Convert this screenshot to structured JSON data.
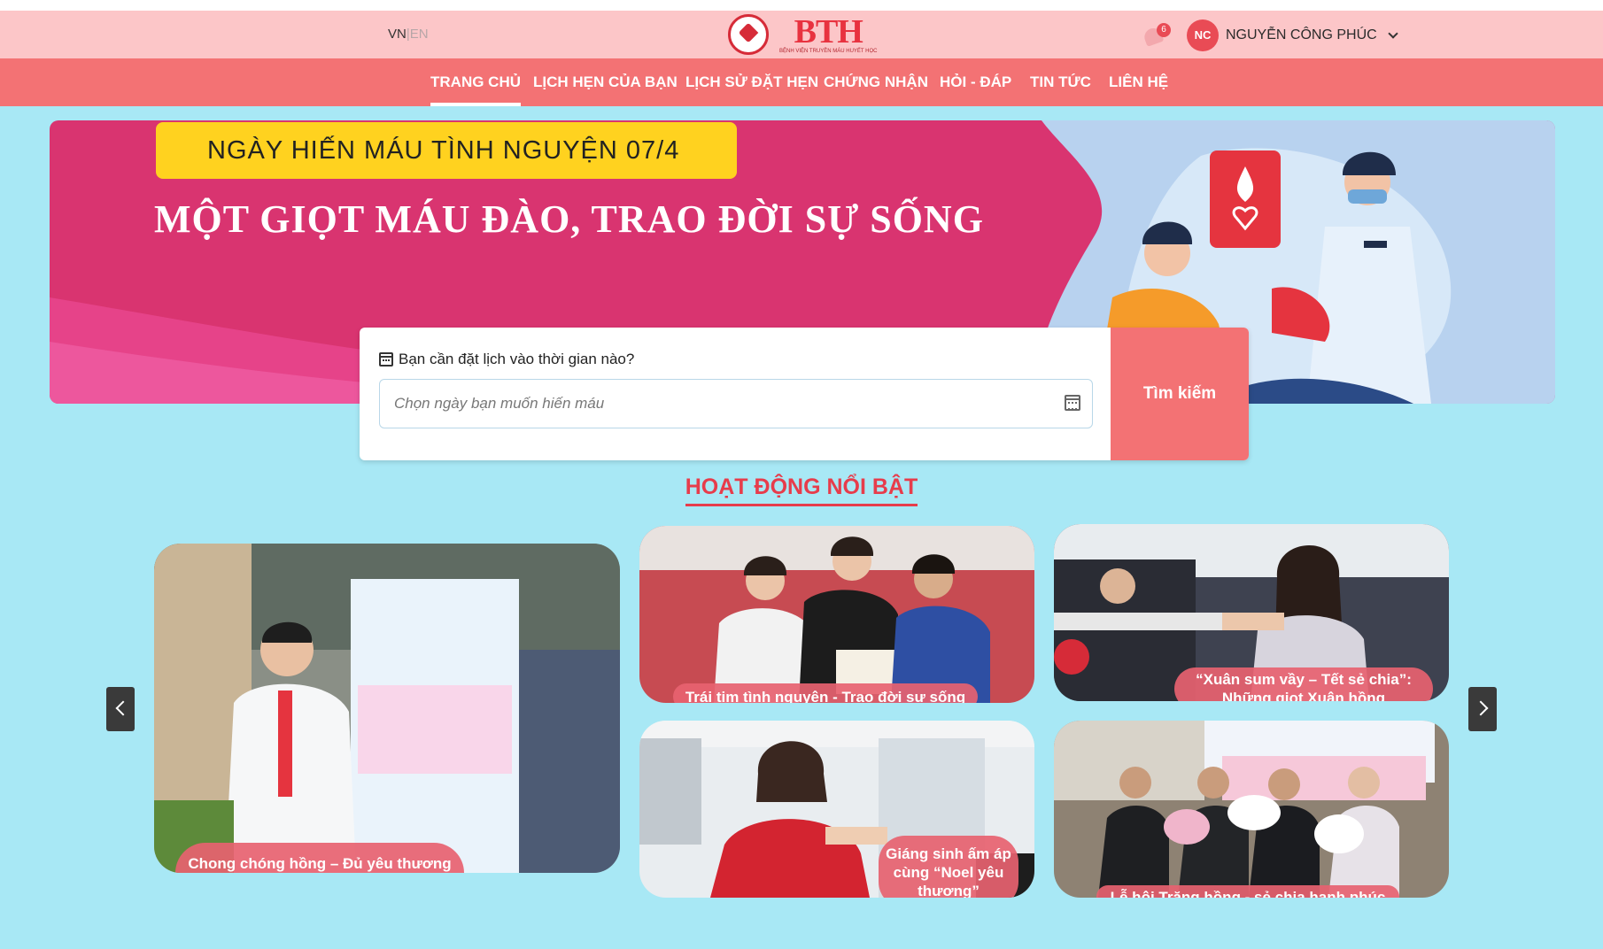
{
  "header": {
    "lang_vn": "VN",
    "lang_sep": "|",
    "lang_en": "EN",
    "logo_text": "BTH",
    "logo_subtitle": "BỆNH VIỆN TRUYỀN MÁU HUYẾT HỌC",
    "notification_count": "6",
    "user_initials": "NC",
    "user_name": "NGUYỄN CÔNG PHÚC"
  },
  "nav": {
    "items": [
      {
        "label": "TRANG CHỦ",
        "active": true
      },
      {
        "label": "LỊCH HẸN CỦA BẠN"
      },
      {
        "label": "LỊCH SỬ ĐẶT HẸN"
      },
      {
        "label": "CHỨNG NHẬN"
      },
      {
        "label": "HỎI - ĐÁP"
      },
      {
        "label": "TIN TỨC"
      },
      {
        "label": "LIÊN HỆ"
      }
    ]
  },
  "hero": {
    "badge": "NGÀY HIẾN MÁU TÌNH NGUYỆN 07/4",
    "title": "MỘT GIỌT MÁU ĐÀO, TRAO ĐỜI SỰ SỐNG"
  },
  "search": {
    "label": "Bạn cần đặt lịch vào thời gian nào?",
    "placeholder": "Chọn ngày bạn muốn hiến máu",
    "button": "Tìm kiếm"
  },
  "section": {
    "title": "HOẠT ĐỘNG NỔI BẬT"
  },
  "activities": [
    {
      "caption": "Chong chóng hồng – Đủ yêu thương hạnh phúc sẽ đong đầy"
    },
    {
      "caption": "Trái tim tình nguyện - Trao đời sự sống"
    },
    {
      "caption": "“Xuân sum vầy – Tết sẻ chia”: Những giọt Xuân hồng"
    },
    {
      "caption": "Giáng sinh ấm áp cùng “Noel yêu thương”"
    },
    {
      "caption": "Lễ hội Trăng hồng - sẻ chia hạnh phúc"
    }
  ],
  "colors": {
    "topbar": "#fcc6c8",
    "navbar": "#f37274",
    "accent": "#e73c4b",
    "background": "#a8e8f5"
  }
}
